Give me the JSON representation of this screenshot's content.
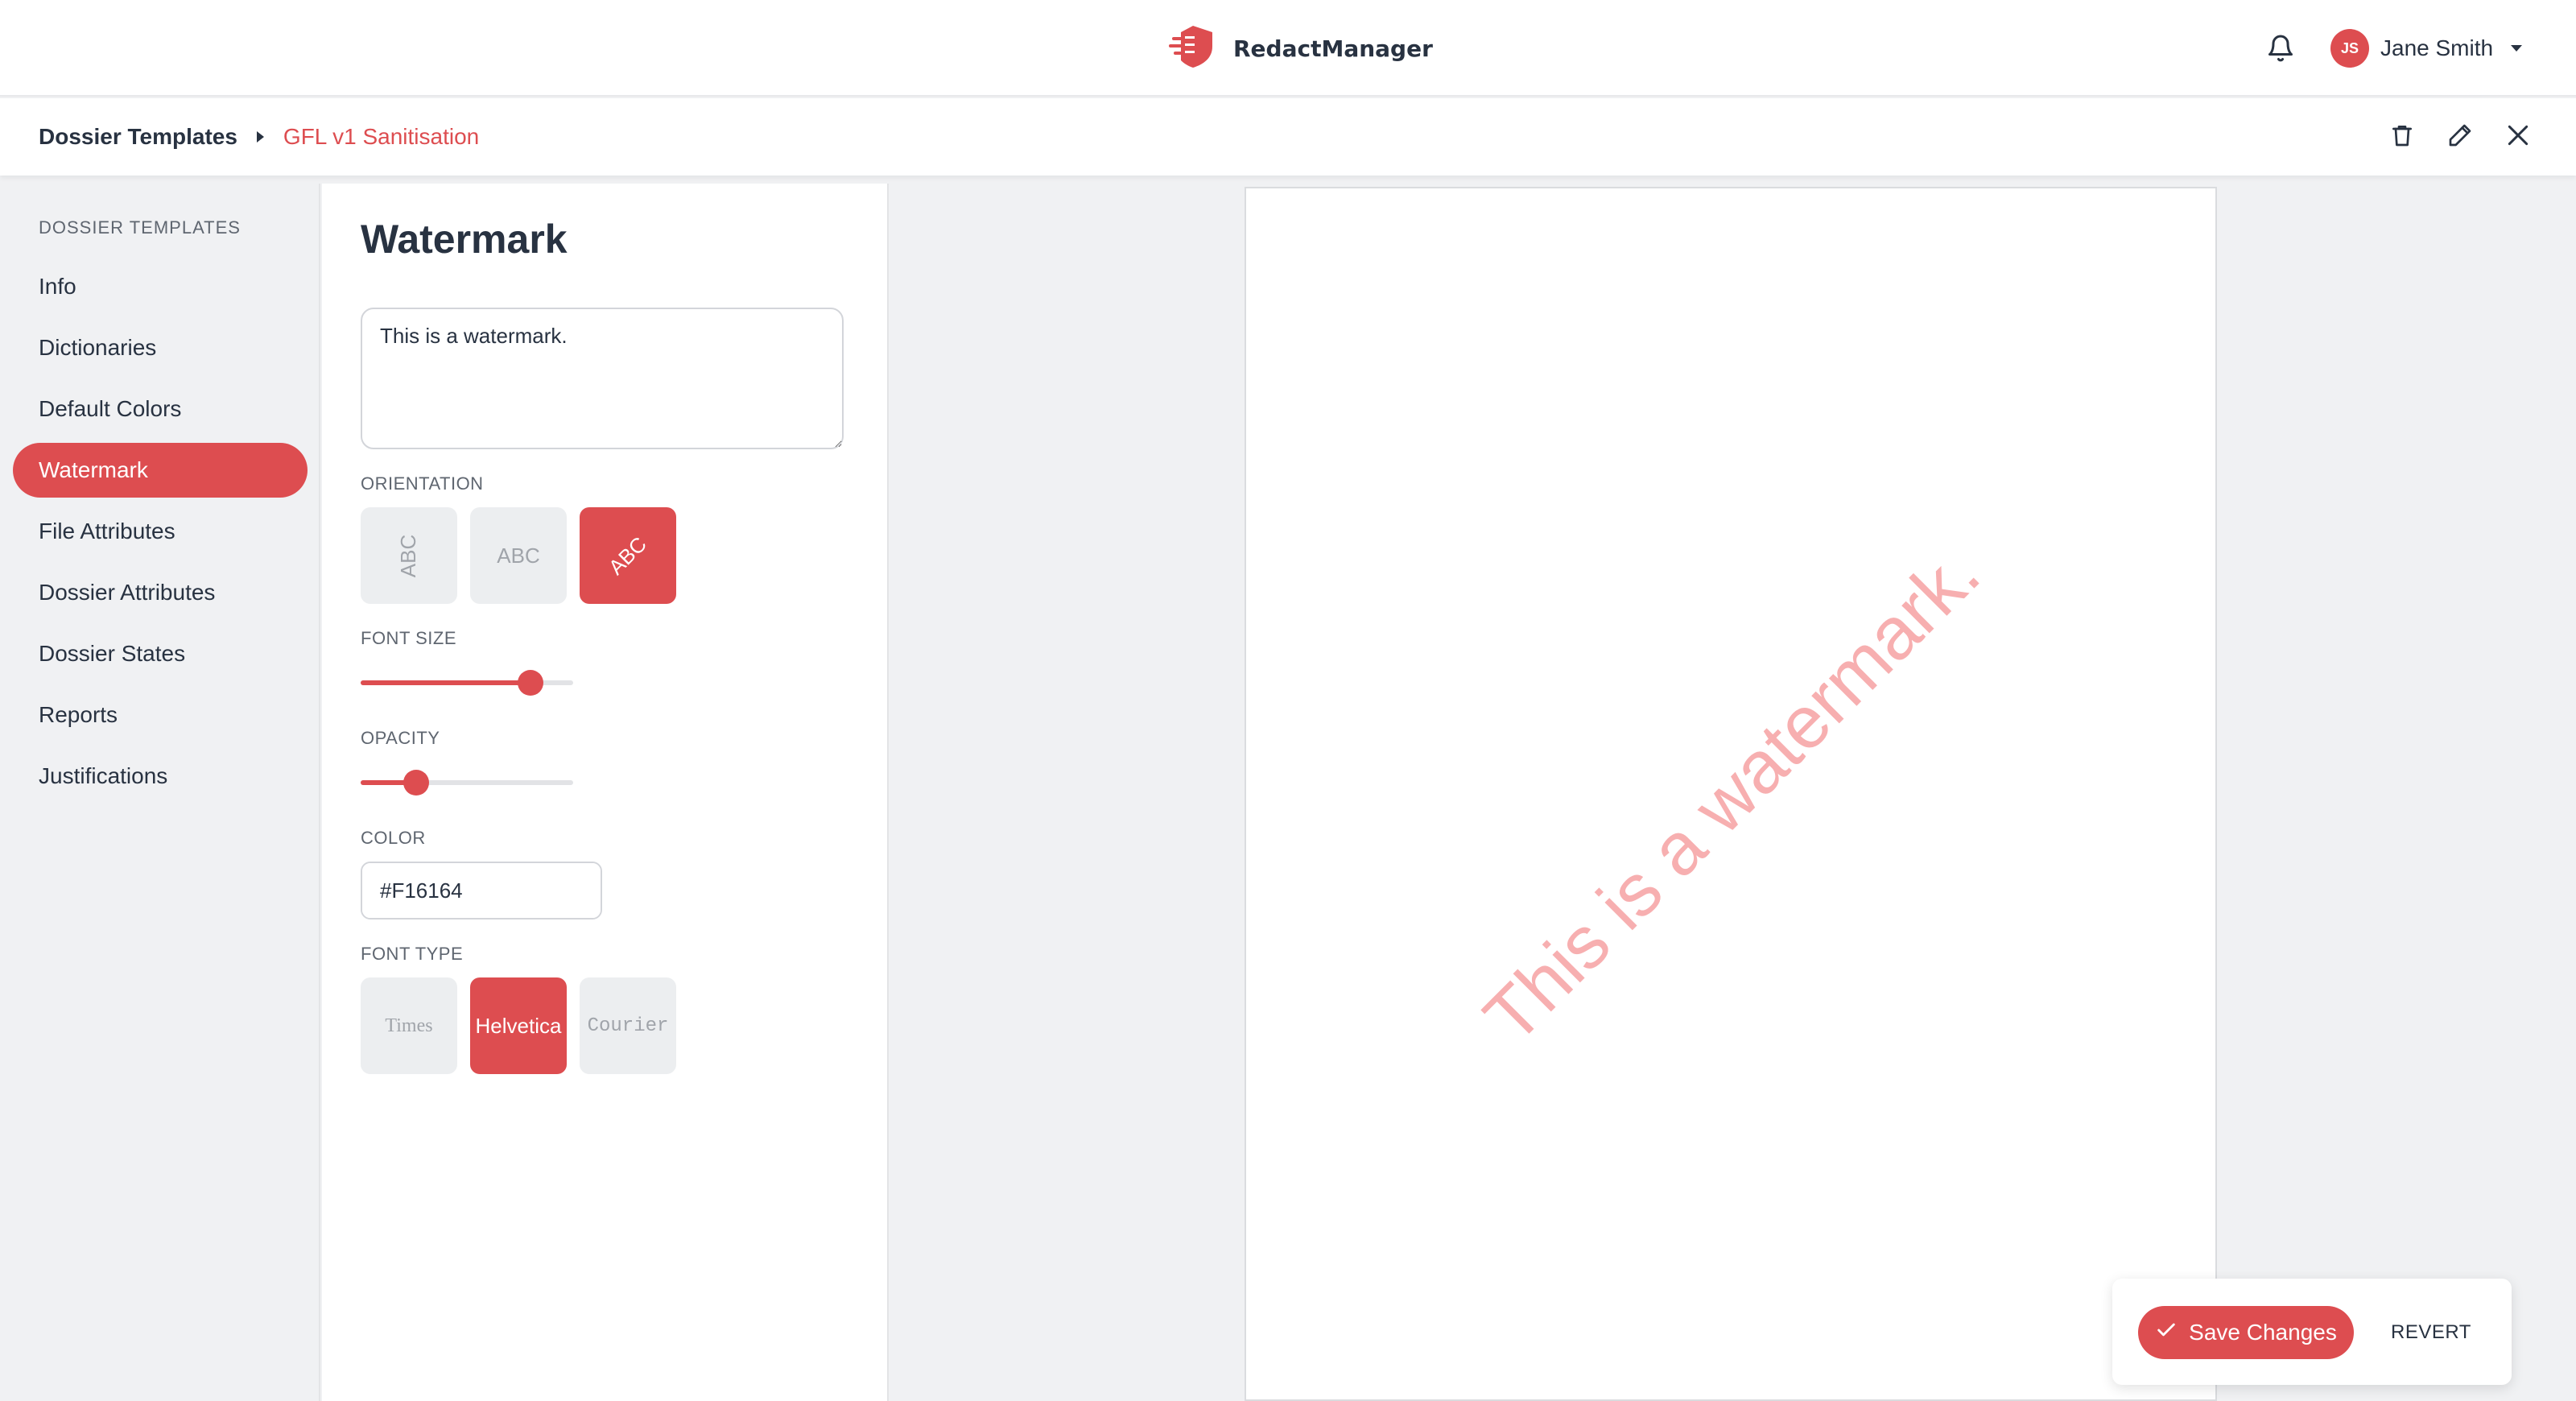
{
  "app": {
    "name": "RedactManager",
    "logo_icon": "shield-logo-icon",
    "brand_color": "#dd4d50"
  },
  "header": {
    "notification_icon": "bell-icon",
    "user": {
      "initials": "JS",
      "name": "Jane Smith"
    }
  },
  "breadcrumb": {
    "parent": "Dossier Templates",
    "current": "GFL v1 Sanitisation",
    "actions": [
      "trash-icon",
      "pencil-icon",
      "close-icon"
    ]
  },
  "sidebar": {
    "title": "DOSSIER TEMPLATES",
    "items": [
      {
        "label": "Info"
      },
      {
        "label": "Dictionaries"
      },
      {
        "label": "Default Colors"
      },
      {
        "label": "Watermark",
        "active": true
      },
      {
        "label": "File Attributes"
      },
      {
        "label": "Dossier Attributes"
      },
      {
        "label": "Dossier States"
      },
      {
        "label": "Reports"
      },
      {
        "label": "Justifications"
      }
    ]
  },
  "watermark": {
    "title": "Watermark",
    "text": "This is a watermark.",
    "orientation": {
      "label": "ORIENTATION",
      "options": [
        "ABC",
        "ABC",
        "ABC"
      ],
      "selected": "diagonal"
    },
    "font_size": {
      "label": "FONT SIZE",
      "value_fraction": 0.8
    },
    "opacity": {
      "label": "OPACITY",
      "value_fraction": 0.26
    },
    "color": {
      "label": "COLOR",
      "value": "#F16164"
    },
    "font_type": {
      "label": "FONT TYPE",
      "options": [
        "Times",
        "Helvetica",
        "Courier"
      ],
      "selected": "Helvetica"
    }
  },
  "actions": {
    "save_label": "Save Changes",
    "revert_label": "REVERT"
  }
}
